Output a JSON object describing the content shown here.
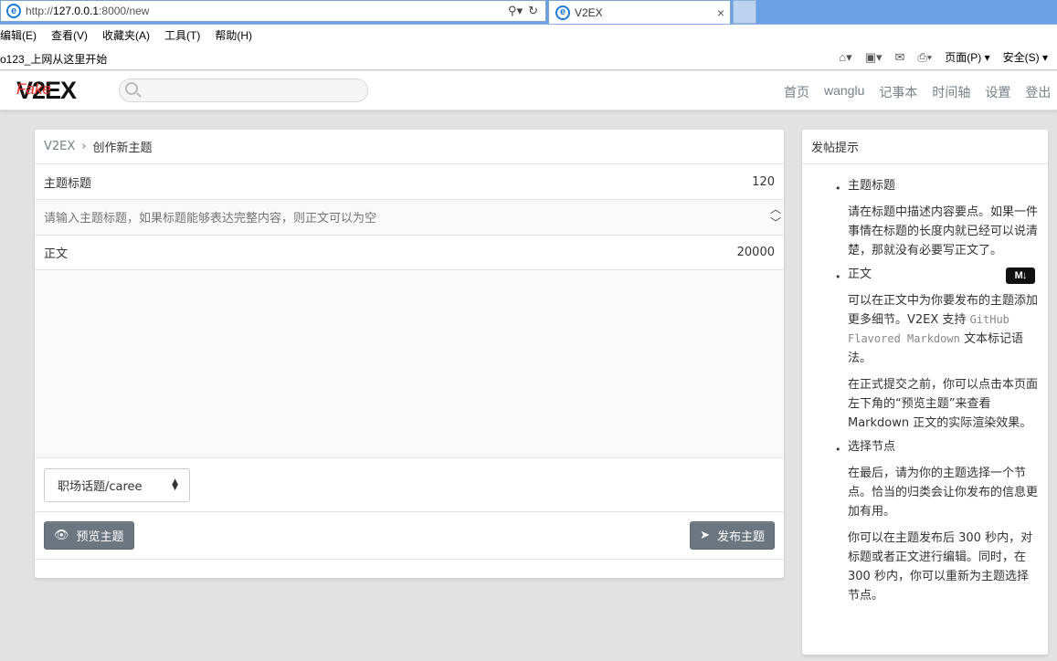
{
  "browser": {
    "url_prefix": "http://",
    "url_host": "127.0.0.1",
    "url_rest": ":8000/new",
    "tab_title": "V2EX",
    "tab_close": "×",
    "menu": [
      "编辑(E)",
      "查看(V)",
      "收藏夹(A)",
      "工具(T)",
      "帮助(H)"
    ],
    "favorites_text": "o123_上网从这里开始",
    "cmd": {
      "page": "页面(P)",
      "safety": "安全(S)"
    }
  },
  "header": {
    "logo": "V2EX",
    "logo_overlay": "Fake",
    "search_placeholder": "",
    "nav": [
      "首页",
      "wanglu",
      "记事本",
      "时间轴",
      "设置",
      "登出"
    ]
  },
  "main": {
    "breadcrumb": {
      "home": "V2EX",
      "separator": "›",
      "current": "创作新主题"
    },
    "title_label": "主题标题",
    "title_limit": "120",
    "title_placeholder": "请输入主题标题，如果标题能够表达完整内容，则正文可以为空",
    "body_label": "正文",
    "body_limit": "20000",
    "node_select": "职场话题/caree",
    "preview_button": "预览主题",
    "publish_button": "发布主题"
  },
  "side": {
    "title": "发帖提示",
    "items": [
      {
        "title": "主题标题",
        "paragraphs": [
          "请在标题中描述内容要点。如果一件事情在标题的长度内就已经可以说清楚，那就没有必要写正文了。"
        ]
      },
      {
        "title": "正文",
        "badge": "M↓",
        "p_pre": "可以在正文中为你要发布的主题添加更多细节。V2EX 支持 ",
        "p_code": "GitHub Flavored Markdown",
        "p_post": " 文本标记语法。",
        "p2": "在正式提交之前，你可以点击本页面左下角的“预览主题”来查看 Markdown 正文的实际渲染效果。"
      },
      {
        "title": "选择节点",
        "paragraphs": [
          "在最后，请为你的主题选择一个节点。恰当的归类会让你发布的信息更加有用。",
          "你可以在主题发布后 300 秒内，对标题或者正文进行编辑。同时，在 300 秒内，你可以重新为主题选择节点。"
        ]
      }
    ]
  },
  "colors": {
    "page_bg": "#e2e2e2",
    "button": "#6b7680",
    "link_gray": "#778087",
    "logo_fake": "#e8322a"
  }
}
